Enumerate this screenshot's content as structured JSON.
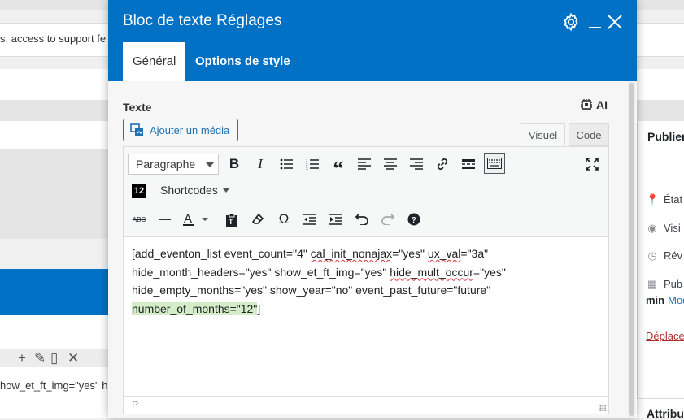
{
  "background": {
    "notice_text": "s, access to support fe",
    "code_snippet": "how_et_ft_img=\"yes\" h"
  },
  "sidebar": {
    "title": "Publier",
    "rows": [
      {
        "icon": "pin-icon",
        "label": "État"
      },
      {
        "icon": "eye-icon",
        "label": "Visi"
      },
      {
        "icon": "clock-icon",
        "label": "Rév"
      },
      {
        "icon": "calendar-icon",
        "label": "Pub"
      }
    ],
    "min_label": "min",
    "modify_link": "Mod",
    "move_link": "Déplace",
    "attributes_title": "Attribu"
  },
  "modal": {
    "title": "Bloc de texte Réglages",
    "tabs": [
      {
        "label": "Général",
        "active": true
      },
      {
        "label": "Options de style",
        "active": false
      }
    ],
    "field_label": "Texte",
    "ai_label": "AI",
    "add_media_label": "Ajouter un média",
    "editor_tabs": {
      "visual": "Visuel",
      "code": "Code"
    },
    "paragraph_select": "Paragraphe",
    "shortcodes_logo": "12",
    "shortcodes_label": "Shortcodes",
    "content": {
      "line1_a": "[add_eventon_list event_count=\"4\" ",
      "line1_b": "cal_init_nonajax",
      "line1_c": "=\"yes\" ",
      "line1_d": "ux_val",
      "line1_e": "=\"3a\"",
      "line2_a": "hide_month_headers=\"yes\" show_et_ft_img=\"yes\" ",
      "line2_b": "hide_mult_occur",
      "line2_c": "=\"yes\"",
      "line3": "hide_empty_months=\"yes\" show_year=\"no\" event_past_future=\"future\"",
      "line4_hl": "number_of_months=\"12\"",
      "line4_end": "]"
    },
    "status_path": "P"
  },
  "colors": {
    "header_blue": "#0071c5",
    "link_blue": "#2271b1",
    "danger_red": "#b32d2e",
    "highlight_green": "#d4edc9"
  }
}
